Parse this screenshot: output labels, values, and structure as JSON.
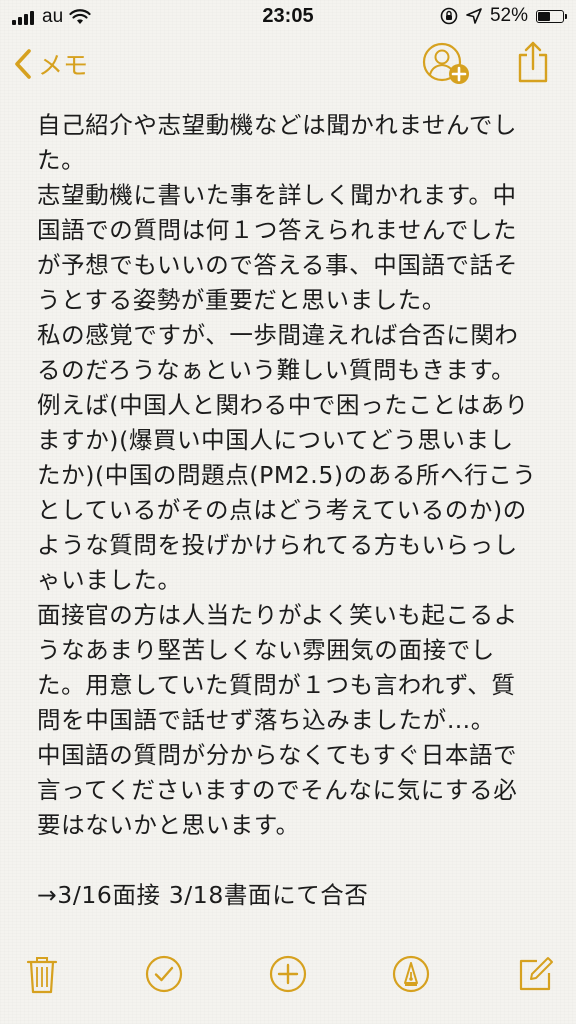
{
  "status_bar": {
    "carrier": "au",
    "time": "23:05",
    "battery_percent": "52%",
    "battery_level": 0.52
  },
  "nav": {
    "back_label": "メモ"
  },
  "note": {
    "lines": [
      "自己紹介や志望動機などは聞かれませんでし",
      "た。",
      "志望動機に書いた事を詳しく聞かれます。中",
      "国語での質問は何１つ答えられませんでした",
      "が予想でもいいので答える事、中国語で話そ",
      "うとする姿勢が重要だと思いました。",
      "私の感覚ですが、一歩間違えれば合否に関わ",
      "るのだろうなぁという難しい質問もきます。",
      "例えば(中国人と関わる中で困ったことはあり",
      "ますか)(爆買い中国人についてどう思いまし",
      "たか)(中国の問題点(PM2.5)のある所へ行こう",
      "としているがその点はどう考えているのか)の",
      "ような質問を投げかけられてる方もいらっし",
      "ゃいました。",
      "面接官の方は人当たりがよく笑いも起こるよ",
      "うなあまり堅苦しくない雰囲気の面接でし",
      "た。用意していた質問が１つも言われず、質",
      "問を中国語で話せず落ち込みましたが…。",
      "中国語の質問が分からなくてもすぐ日本語で",
      "言ってくださいますのでそんなに気にする必",
      "要はないかと思います。",
      "",
      "→3/16面接 3/18書面にて合否"
    ]
  },
  "colors": {
    "accent": "#d6a11f",
    "text": "#1c1c1c",
    "background": "#f4f3ef"
  },
  "icons": {
    "back": "chevron-left-icon",
    "add_people": "add-person-icon",
    "share": "share-icon",
    "trash": "trash-icon",
    "checklist": "checkmark-circle-icon",
    "add": "plus-circle-icon",
    "markup": "pen-tip-icon",
    "compose": "compose-icon"
  }
}
